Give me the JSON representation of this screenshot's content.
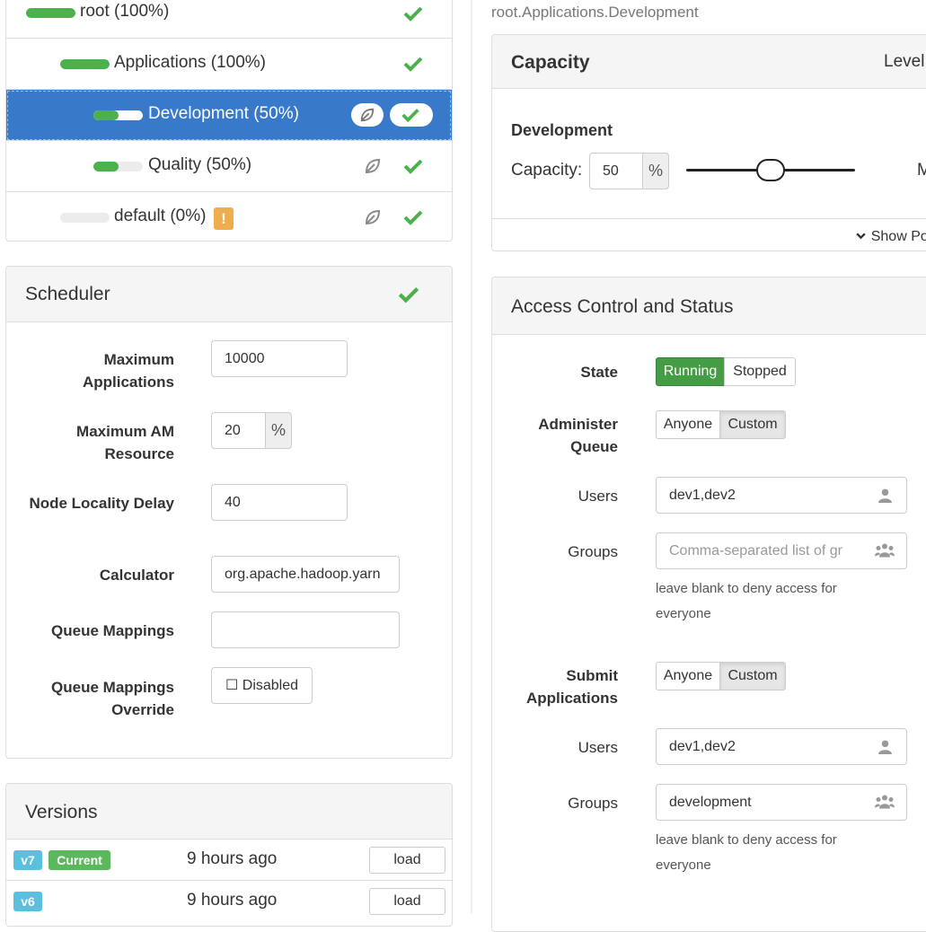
{
  "colors": {
    "accent": "#3879c9",
    "success": "#4cb04c",
    "warning": "#f0ad4e",
    "info": "#5bc0de"
  },
  "tree": {
    "queues": [
      {
        "label": "root (100%)",
        "capacity": 100
      },
      {
        "label": "Applications (100%)",
        "capacity": 100
      },
      {
        "label": "Development (50%)",
        "capacity": 50,
        "selected": true
      },
      {
        "label": "Quality (50%)",
        "capacity": 50
      },
      {
        "label": "default (0%)",
        "capacity": 0,
        "warning": "!"
      }
    ]
  },
  "scheduler": {
    "title": "Scheduler",
    "max_apps_label": "Maximum Applications",
    "max_apps_value": "10000",
    "max_am_label": "Maximum AM Resource",
    "max_am_value": "20",
    "max_am_unit": "%",
    "locality_label": "Node Locality Delay",
    "locality_value": "40",
    "calculator_label": "Calculator",
    "calculator_value": "org.apache.hadoop.yarn",
    "mappings_label": "Queue Mappings",
    "mappings_value": "",
    "override_label": "Queue Mappings Override",
    "override_button": "☐ Disabled"
  },
  "versions": {
    "title": "Versions",
    "items": [
      {
        "tag": "v7",
        "current": "Current",
        "time": "9 hours ago",
        "action": "load"
      },
      {
        "tag": "v6",
        "time": "9 hours ago",
        "action": "load"
      }
    ]
  },
  "breadcrumb": "root.Applications.Development",
  "capacity": {
    "title": "Capacity",
    "level": "Level",
    "queue_name": "Development",
    "field_label": "Capacity:",
    "value": "50",
    "unit": "%",
    "slider_fraction": 0.5,
    "max_cut": "M",
    "show_more": "Show Po"
  },
  "access": {
    "title": "Access Control and Status",
    "state_label": "State",
    "state_options": [
      "Running",
      "Stopped"
    ],
    "state_selected": "Running",
    "admin_label": "Administer Queue",
    "admin_options": [
      "Anyone",
      "Custom"
    ],
    "admin_selected": "Custom",
    "admin_users_label": "Users",
    "admin_users_value": "dev1,dev2",
    "admin_groups_label": "Groups",
    "admin_groups_placeholder": "Comma-separated list of gr",
    "admin_help": "leave blank to deny access for everyone",
    "submit_label": "Submit Applications",
    "submit_options": [
      "Anyone",
      "Custom"
    ],
    "submit_selected": "Custom",
    "submit_users_label": "Users",
    "submit_users_value": "dev1,dev2",
    "submit_groups_label": "Groups",
    "submit_groups_value": "development",
    "submit_help": "leave blank to deny access for everyone"
  }
}
